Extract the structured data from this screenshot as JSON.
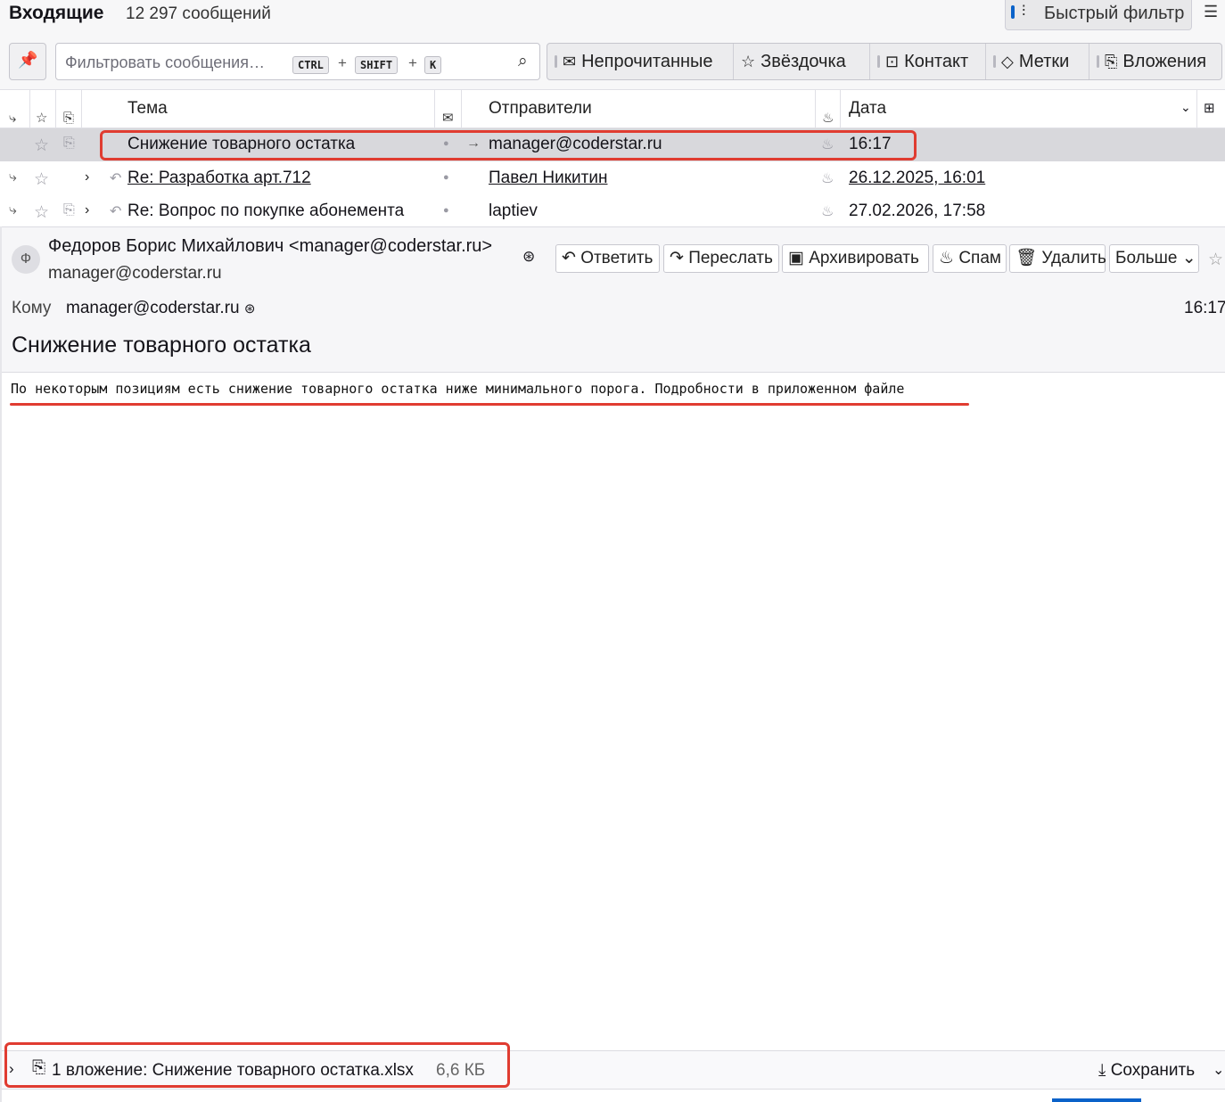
{
  "folder": {
    "title": "Входящие",
    "count": "12 297 сообщений"
  },
  "quick_filter": {
    "label": "Быстрый фильтр"
  },
  "search": {
    "placeholder": "Фильтровать сообщения…",
    "keys": [
      "CTRL",
      "SHIFT",
      "K"
    ]
  },
  "filters": [
    {
      "label": "Непрочитанные",
      "icon": "envelope-icon"
    },
    {
      "label": "Звёздочка",
      "icon": "star-icon"
    },
    {
      "label": "Контакт",
      "icon": "contact-icon"
    },
    {
      "label": "Метки",
      "icon": "tag-icon"
    },
    {
      "label": "Вложения",
      "icon": "paperclip-icon"
    }
  ],
  "columns": {
    "subject": "Тема",
    "senders": "Отправители",
    "date": "Дата"
  },
  "messages": [
    {
      "subject": "Снижение товарного остатка",
      "sender": "manager@coderstar.ru",
      "date": "16:17",
      "selected": true,
      "attachment": true
    },
    {
      "subject": "Re: Разработка арт.712",
      "sender": "Павел Никитин",
      "date": "26.12.2025, 16:01",
      "reply": true,
      "unread": true
    },
    {
      "subject": "Re: Вопрос по покупке абонемента",
      "sender": "laptiev",
      "date": "27.02.2026, 17:58",
      "reply": true,
      "attachment": true
    }
  ],
  "header": {
    "avatar_letter": "Ф",
    "from": "Федоров Борис Михайлович <manager@coderstar.ru>",
    "from_email": "manager@coderstar.ru",
    "to_label": "Кому",
    "to": "manager@coderstar.ru",
    "time": "16:17",
    "subject": "Снижение товарного остатка",
    "actions": {
      "reply": "Ответить",
      "forward": "Переслать",
      "archive": "Архивировать",
      "spam": "Спам",
      "delete": "Удалить",
      "more": "Больше"
    }
  },
  "body": "По некоторым позициям есть снижение товарного остатка ниже минимального порога. Подробности в приложенном файле",
  "attachments": {
    "summary": "1 вложение: Снижение товарного остатка.xlsx",
    "size": "6,6 КБ",
    "save": "Сохранить"
  },
  "colors": {
    "accent": "#0a62c9",
    "annotation": "#e03c31",
    "selected_row": "#d8d8dc"
  }
}
